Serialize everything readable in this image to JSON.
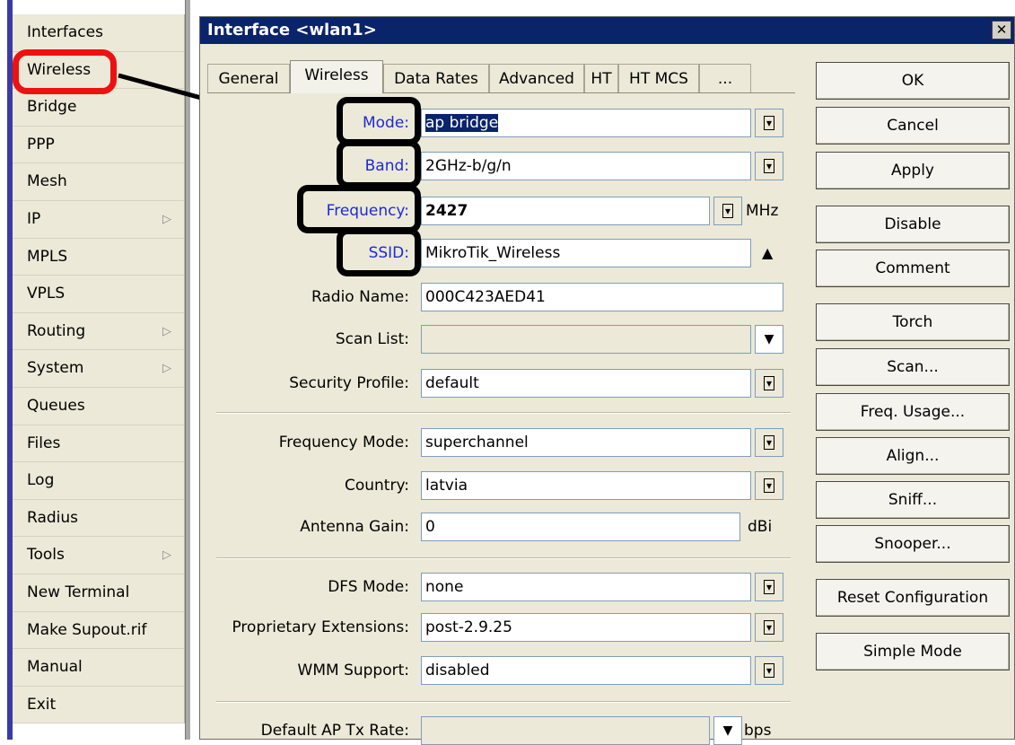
{
  "sidebar": {
    "items": [
      {
        "label": "Interfaces",
        "arrow": false
      },
      {
        "label": "Wireless",
        "arrow": false
      },
      {
        "label": "Bridge",
        "arrow": false
      },
      {
        "label": "PPP",
        "arrow": false
      },
      {
        "label": "Mesh",
        "arrow": false
      },
      {
        "label": "IP",
        "arrow": true
      },
      {
        "label": "MPLS",
        "arrow": false
      },
      {
        "label": "VPLS",
        "arrow": false
      },
      {
        "label": "Routing",
        "arrow": true
      },
      {
        "label": "System",
        "arrow": true
      },
      {
        "label": "Queues",
        "arrow": false
      },
      {
        "label": "Files",
        "arrow": false
      },
      {
        "label": "Log",
        "arrow": false
      },
      {
        "label": "Radius",
        "arrow": false
      },
      {
        "label": "Tools",
        "arrow": true
      },
      {
        "label": "New Terminal",
        "arrow": false
      },
      {
        "label": "Make Supout.rif",
        "arrow": false
      },
      {
        "label": "Manual",
        "arrow": false
      },
      {
        "label": "Exit",
        "arrow": false
      }
    ],
    "arrow_glyph": "▷"
  },
  "dialog": {
    "title": "Interface <wlan1>",
    "close_glyph": "✕",
    "tabs": [
      "General",
      "Wireless",
      "Data Rates",
      "Advanced",
      "HT",
      "HT MCS",
      "..."
    ],
    "active_tab": "Wireless"
  },
  "form": {
    "mode": {
      "label": "Mode:",
      "value": "ap bridge"
    },
    "band": {
      "label": "Band:",
      "value": "2GHz-b/g/n"
    },
    "frequency": {
      "label": "Frequency:",
      "value": "2427",
      "unit": "MHz"
    },
    "ssid": {
      "label": "SSID:",
      "value": "MikroTik_Wireless"
    },
    "radio_name": {
      "label": "Radio Name:",
      "value": "000C423AED41"
    },
    "scan_list": {
      "label": "Scan List:",
      "value": ""
    },
    "security_profile": {
      "label": "Security Profile:",
      "value": "default"
    },
    "frequency_mode": {
      "label": "Frequency Mode:",
      "value": "superchannel"
    },
    "country": {
      "label": "Country:",
      "value": "latvia"
    },
    "antenna_gain": {
      "label": "Antenna Gain:",
      "value": "0",
      "unit": "dBi"
    },
    "dfs_mode": {
      "label": "DFS Mode:",
      "value": "none"
    },
    "proprietary_extensions": {
      "label": "Proprietary Extensions:",
      "value": "post-2.9.25"
    },
    "wmm_support": {
      "label": "WMM Support:",
      "value": "disabled"
    },
    "default_ap_tx_rate": {
      "label": "Default AP Tx Rate:",
      "value": "",
      "unit": "bps"
    }
  },
  "buttons": {
    "ok": "OK",
    "cancel": "Cancel",
    "apply": "Apply",
    "disable": "Disable",
    "comment": "Comment",
    "torch": "Torch",
    "scan": "Scan...",
    "freq_usage": "Freq. Usage...",
    "align": "Align...",
    "sniff": "Sniff...",
    "snooper": "Snooper...",
    "reset_configuration": "Reset Configuration",
    "simple_mode": "Simple Mode"
  },
  "glyphs": {
    "dropdown": "▼",
    "dropdown_boxed": "▾",
    "collapse": "▲"
  },
  "colors": {
    "title_bar": "#0a246a",
    "highlight_label": "#1b2bd4",
    "annotation_red": "#ee1111"
  }
}
